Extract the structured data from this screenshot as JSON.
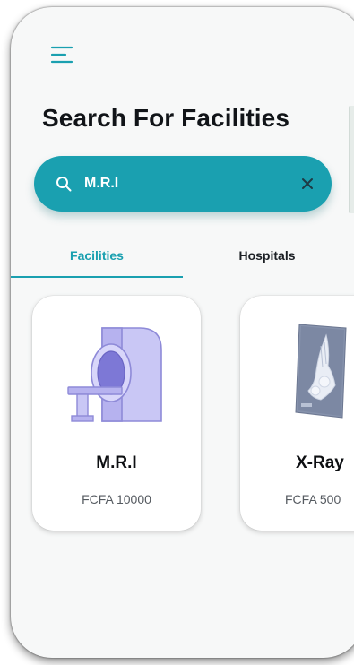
{
  "header": {
    "menu_icon": "hamburger-menu-icon",
    "title": "Search For Facilities"
  },
  "search": {
    "icon": "search-icon",
    "value": "M.R.I",
    "clear_icon": "close-icon"
  },
  "tabs": [
    {
      "label": "Facilities",
      "active": true
    },
    {
      "label": "Hospitals",
      "active": false
    }
  ],
  "facilities": [
    {
      "name": "M.R.I",
      "price": "FCFA 10000",
      "image": "mri-scanner-illustration"
    },
    {
      "name": "X-Ray",
      "price": "FCFA 500",
      "image": "xray-foot-illustration"
    }
  ],
  "colors": {
    "accent": "#1aa0b0",
    "background": "#f7f8f8",
    "card": "#ffffff",
    "title": "#111418",
    "price": "#555a60"
  }
}
